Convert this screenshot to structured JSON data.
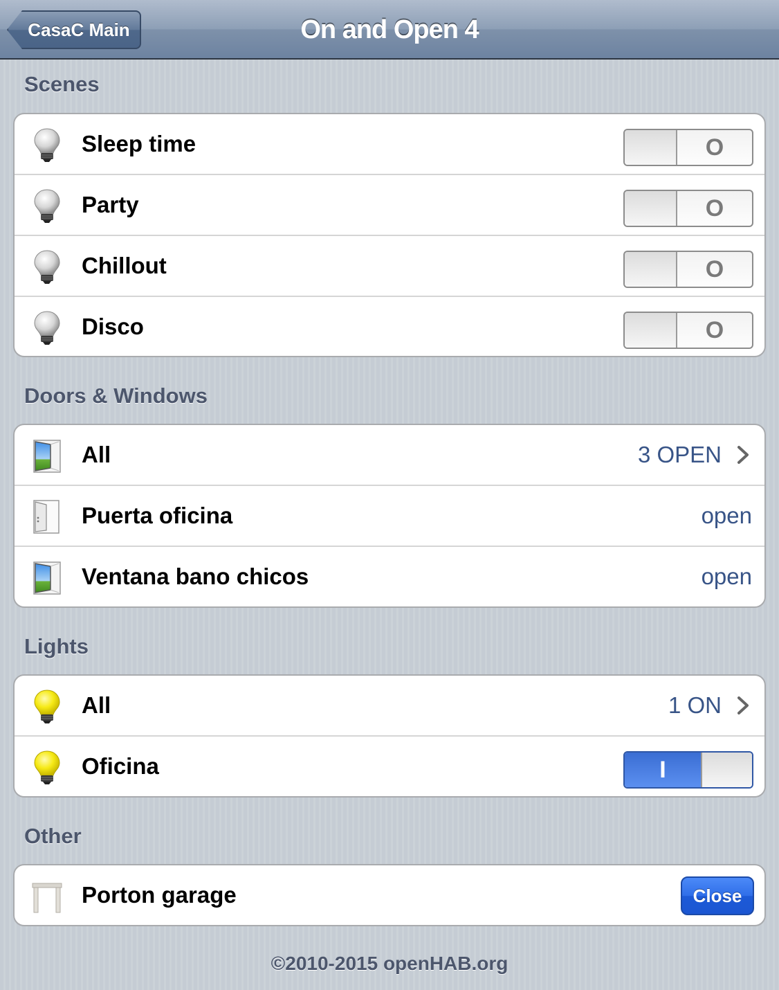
{
  "navbar": {
    "back_label": "CasaC Main",
    "title": "On and Open 4"
  },
  "sections": {
    "scenes": {
      "title": "Scenes",
      "items": [
        {
          "label": "Sleep time",
          "icon": "bulb-off-icon",
          "control": "toggle",
          "state_label": "O"
        },
        {
          "label": "Party",
          "icon": "bulb-off-icon",
          "control": "toggle",
          "state_label": "O"
        },
        {
          "label": "Chillout",
          "icon": "bulb-off-icon",
          "control": "toggle",
          "state_label": "O"
        },
        {
          "label": "Disco",
          "icon": "bulb-off-icon",
          "control": "toggle",
          "state_label": "O"
        }
      ]
    },
    "doors": {
      "title": "Doors & Windows",
      "items": [
        {
          "label": "All",
          "icon": "window-open-icon",
          "value": "3 OPEN"
        },
        {
          "label": "Puerta oficina",
          "icon": "door-open-icon",
          "value": "open"
        },
        {
          "label": "Ventana bano chicos",
          "icon": "window-open-icon",
          "value": "open"
        }
      ]
    },
    "lights": {
      "title": "Lights",
      "items": [
        {
          "label": "All",
          "icon": "bulb-on-icon",
          "value": "1 ON"
        },
        {
          "label": "Oficina",
          "icon": "bulb-on-icon",
          "control": "toggle",
          "state_label": "I"
        }
      ]
    },
    "other": {
      "title": "Other",
      "items": [
        {
          "label": "Porton garage",
          "icon": "garage-icon",
          "button_label": "Close"
        }
      ]
    }
  },
  "footer": "©2010-2015 openHAB.org",
  "colors": {
    "accent_blue": "#2f6ee8",
    "value_text": "#385487",
    "section_text": "#4c566c"
  }
}
